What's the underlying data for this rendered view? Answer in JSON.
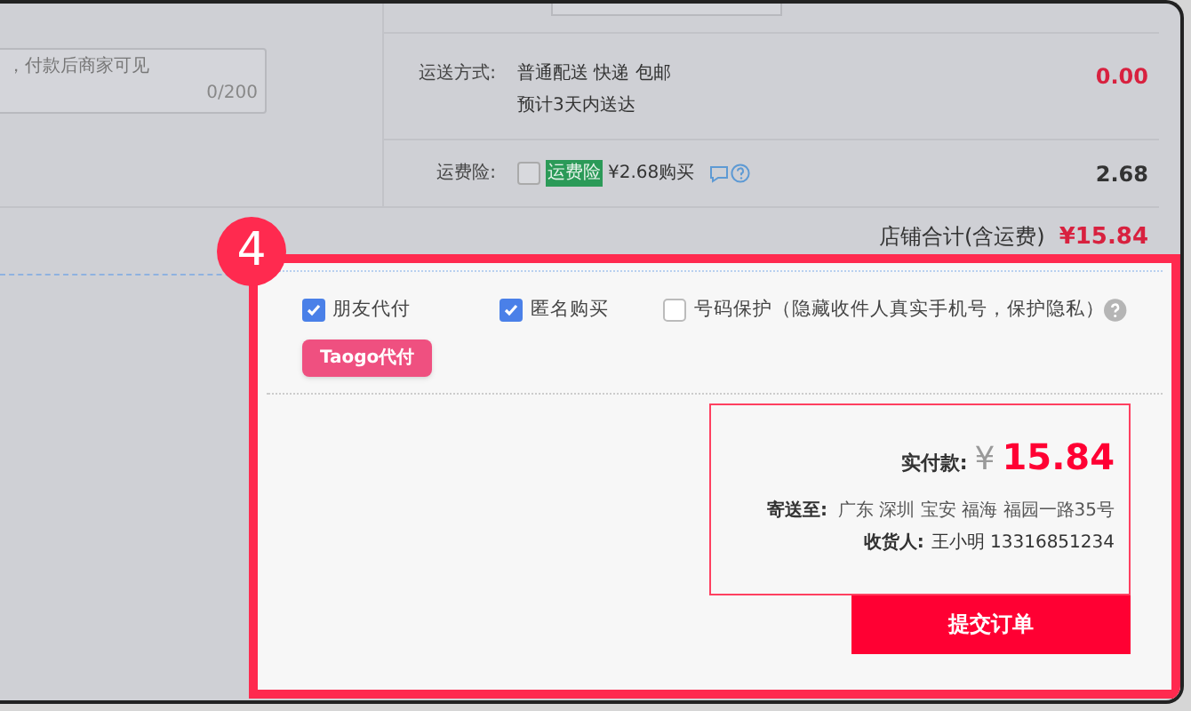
{
  "message_field": {
    "placeholder": "，付款后商家可见",
    "counter": "0/200"
  },
  "shipping": {
    "label": "运送方式:",
    "methods": "普通配送 快递 包邮",
    "eta": "预计3天内送达",
    "amount": "0.00"
  },
  "insurance": {
    "label": "运费险:",
    "checked": false,
    "tag": "运费险",
    "price": "¥2.68购买",
    "amount": "2.68"
  },
  "store_total": {
    "label": "店铺合计(含运费)",
    "amount": "¥15.84"
  },
  "step_badge": "4",
  "options": [
    {
      "label": "朋友代付",
      "checked": true
    },
    {
      "label": "匿名购买",
      "checked": true
    },
    {
      "label": "号码保护（隐藏收件人真实手机号，保护隐私）",
      "checked": false
    }
  ],
  "tooltip": "Taogo代付",
  "summary": {
    "pay_label": "实付款:",
    "currency": "¥",
    "amount": "15.84",
    "address_label": "寄送至:",
    "address": "广东 深圳 宝安 福海 福园一路35号",
    "receiver_label": "收货人:",
    "receiver": "王小明 13316851234"
  },
  "submit_button": "提交订单"
}
